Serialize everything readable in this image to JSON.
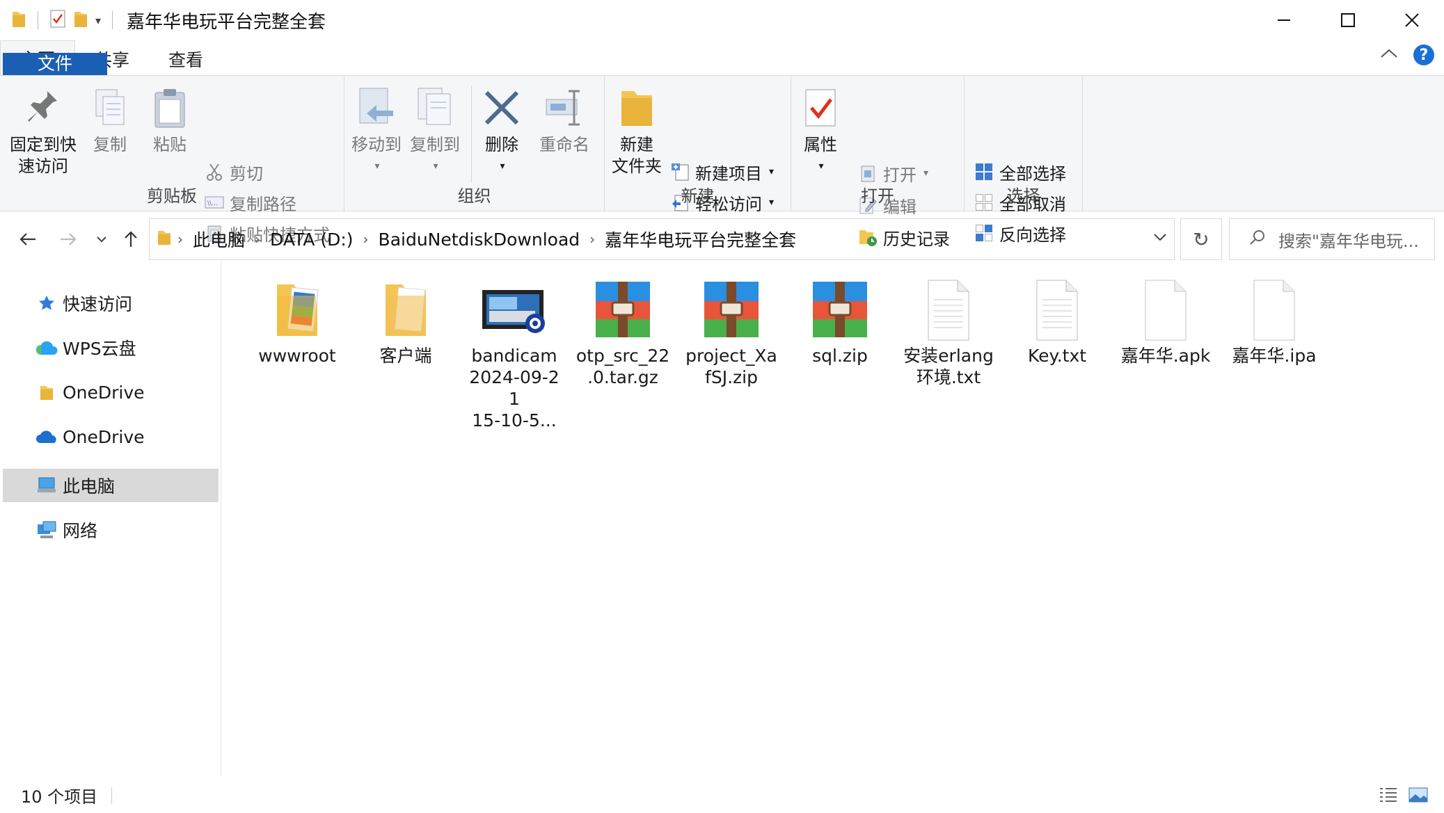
{
  "window": {
    "title": "嘉年华电玩平台完整全套",
    "colors": {
      "accent": "#1a5fb4",
      "folder": "#f3c654",
      "selected": "#d9d9d9"
    }
  },
  "tabs": [
    {
      "label": "文件"
    },
    {
      "label": "主页"
    },
    {
      "label": "共享"
    },
    {
      "label": "查看"
    }
  ],
  "ribbon": {
    "clipboard": {
      "label": "剪贴板",
      "pin_line1": "固定到快",
      "pin_line2": "速访问",
      "copy": "复制",
      "paste": "粘贴",
      "cut": "剪切",
      "copy_path": "复制路径",
      "paste_shortcut": "粘贴快捷方式"
    },
    "organize": {
      "label": "组织",
      "move_to": "移动到",
      "copy_to": "复制到",
      "delete": "删除",
      "rename": "重命名"
    },
    "new": {
      "label": "新建",
      "new_folder_line1": "新建",
      "new_folder_line2": "文件夹",
      "new_item": "新建项目",
      "easy_access": "轻松访问"
    },
    "open": {
      "label": "打开",
      "properties": "属性",
      "open": "打开",
      "edit": "编辑",
      "history": "历史记录"
    },
    "select": {
      "label": "选择",
      "select_all": "全部选择",
      "select_none": "全部取消",
      "invert": "反向选择"
    }
  },
  "address": {
    "crumbs": [
      "此电脑",
      "DATA (D:)",
      "BaiduNetdiskDownload",
      "嘉年华电玩平台完整全套"
    ],
    "search_placeholder": "搜索\"嘉年华电玩..."
  },
  "navpane": [
    {
      "label": "快速访问",
      "icon": "star-icon"
    },
    {
      "label": "WPS云盘",
      "icon": "cloud-icon"
    },
    {
      "label": "OneDrive",
      "icon": "folder-icon"
    },
    {
      "label": "OneDrive",
      "icon": "onedrive-cloud-icon"
    },
    {
      "label": "此电脑",
      "icon": "computer-icon",
      "selected": true
    },
    {
      "label": "网络",
      "icon": "network-icon"
    }
  ],
  "files": [
    {
      "name": "wwwroot",
      "type": "folder-image"
    },
    {
      "name": "客户端",
      "type": "folder"
    },
    {
      "name_lines": [
        "bandicam",
        "2024-09-2",
        "1",
        "15-10-5..."
      ],
      "type": "video"
    },
    {
      "name_lines": [
        "otp_src_22",
        ".0.tar.gz"
      ],
      "type": "archive"
    },
    {
      "name_lines": [
        "project_Xa",
        "fSJ.zip"
      ],
      "type": "archive"
    },
    {
      "name": "sql.zip",
      "type": "archive"
    },
    {
      "name_lines": [
        "安装erlang",
        "环境.txt"
      ],
      "type": "text"
    },
    {
      "name": "Key.txt",
      "type": "text"
    },
    {
      "name": "嘉年华.apk",
      "type": "blank"
    },
    {
      "name": "嘉年华.ipa",
      "type": "blank"
    }
  ],
  "status": {
    "item_count": "10 个项目"
  }
}
